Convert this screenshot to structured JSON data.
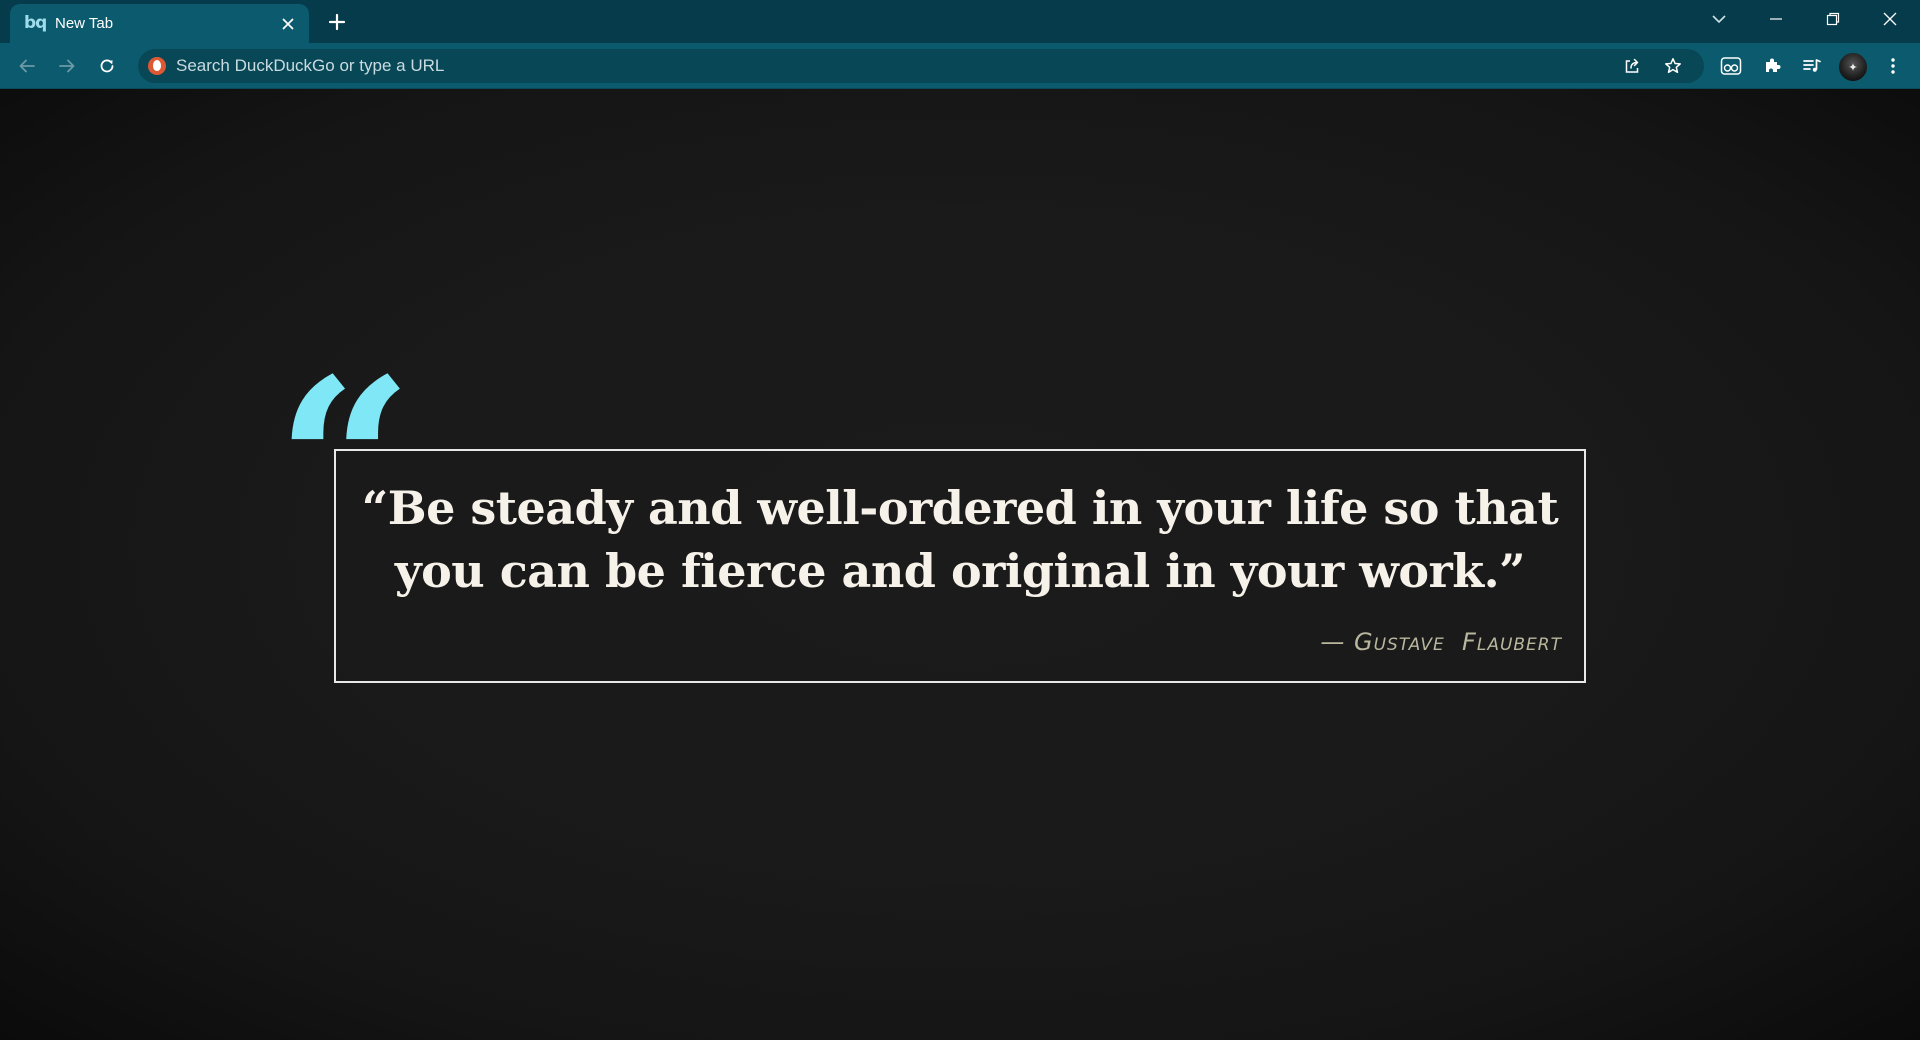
{
  "browser": {
    "colors": {
      "tabstrip": "#053b4a",
      "active_tab": "#0c5a6d",
      "toolbar": "#0c5a6d",
      "omnibox": "#084756",
      "quote_mark": "#7fe7f5"
    }
  },
  "tabs": [
    {
      "title": "New Tab",
      "favicon": "bq-logo-icon",
      "active": true
    }
  ],
  "tabstrip": {
    "new_tab_icon": "plus-icon",
    "tab_search_icon": "chevron-down-icon",
    "minimize_icon": "minimize-icon",
    "restore_icon": "restore-icon",
    "close_icon": "close-icon"
  },
  "toolbar": {
    "back_icon": "arrow-left-icon",
    "forward_icon": "arrow-right-icon",
    "reload_icon": "reload-icon",
    "omnibox": {
      "placeholder": "Search DuckDuckGo or type a URL",
      "value": "",
      "search_engine_icon": "duckduckgo-icon",
      "share_icon": "share-icon",
      "bookmark_icon": "star-icon"
    },
    "extensions": [
      "reader-extension-icon",
      "puzzle-icon",
      "media-queue-icon"
    ],
    "profile_icon": "avatar",
    "menu_icon": "kebab-menu-icon"
  },
  "quote": {
    "text": "“Be steady and well-ordered in your life so that you can be fierce and original in your work.”",
    "author": "— Gustave  Flaubert",
    "decorative_mark": "“"
  }
}
